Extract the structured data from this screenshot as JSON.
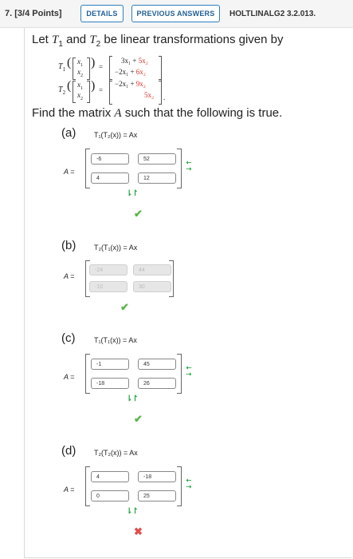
{
  "header": {
    "question_number": "7.",
    "points": "[3/4 Points]",
    "details_label": "DETAILS",
    "previous_answers_label": "PREVIOUS ANSWERS",
    "problem_code": "HOLTLINALG2 3.2.013."
  },
  "problem": {
    "statement_prefix": "Let ",
    "statement_mid": " and ",
    "statement_suffix": " be linear transformations given by",
    "t1": "T",
    "t1_sub": "1",
    "t2": "T",
    "t2_sub": "2",
    "x1": "x",
    "x1_sub": "1",
    "x2": "x",
    "x2_sub": "2",
    "t1_row1": "3x₁ + ",
    "t1_row1_red": "5x₂",
    "t1_row2": "−2x₁ + ",
    "t1_row2_red": "6x₂",
    "t2_row1": "−2x₁ + ",
    "t2_row1_red": "9x₂",
    "t2_row2_red": "5x₂",
    "find_prefix": "Find the matrix ",
    "find_var": "A",
    "find_suffix": " such that the following is true."
  },
  "parts": [
    {
      "label": "(a)",
      "equation": "T₁(T₂(x)) = Ax",
      "a_label": "A =",
      "cells": [
        "-6",
        "52",
        "4",
        "12"
      ],
      "disabled": false,
      "result": "correct"
    },
    {
      "label": "(b)",
      "equation": "T₂(T₁(x)) = Ax",
      "a_label": "A =",
      "cells": [
        "-24",
        "44",
        "-10",
        "30"
      ],
      "disabled": true,
      "result": "correct"
    },
    {
      "label": "(c)",
      "equation": "T₁(T₁(x)) = Ax",
      "a_label": "A =",
      "cells": [
        "-1",
        "45",
        "-18",
        "26"
      ],
      "disabled": false,
      "result": "correct"
    },
    {
      "label": "(d)",
      "equation": "T₂(T₂(x)) = Ax",
      "a_label": "A =",
      "cells": [
        "4",
        "-18",
        "0",
        "25"
      ],
      "disabled": false,
      "result": "incorrect"
    }
  ],
  "icons": {
    "correct": "✔",
    "incorrect": "✖",
    "row_insert_delete": "⇠⇢",
    "col_swap": "⇂↾"
  },
  "colors": {
    "accent_blue": "#2e7fbf",
    "correct_green": "#5bb54a",
    "incorrect_red": "#e24e4e",
    "emphasis_red": "#d9342b"
  }
}
